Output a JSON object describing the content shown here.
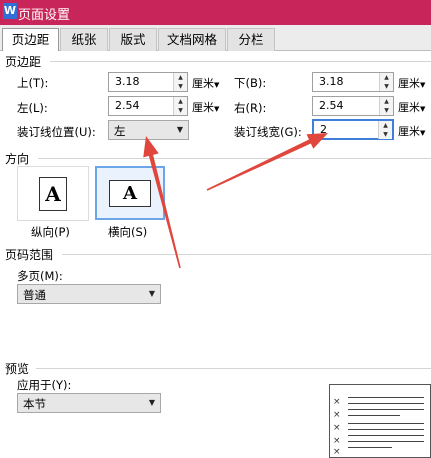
{
  "window": {
    "title": "页面设置",
    "app_icon": "W"
  },
  "tabs": [
    {
      "label": "页边距",
      "active": true
    },
    {
      "label": "纸张",
      "active": false
    },
    {
      "label": "版式",
      "active": false
    },
    {
      "label": "文档网格",
      "active": false
    },
    {
      "label": "分栏",
      "active": false
    }
  ],
  "margins": {
    "section_title": "页边距",
    "top": {
      "label": "上(T):",
      "value": "3.18",
      "unit": "厘米"
    },
    "bottom": {
      "label": "下(B):",
      "value": "3.18",
      "unit": "厘米"
    },
    "left": {
      "label": "左(L):",
      "value": "2.54",
      "unit": "厘米"
    },
    "right": {
      "label": "右(R):",
      "value": "2.54",
      "unit": "厘米"
    },
    "gutter_position": {
      "label": "装订线位置(U):",
      "value": "左"
    },
    "gutter_width": {
      "label": "装订线宽(G):",
      "value": "2",
      "unit": "厘米"
    }
  },
  "orientation": {
    "section_title": "方向",
    "portrait": {
      "label": "纵向(P)",
      "glyph": "A",
      "selected": false
    },
    "landscape": {
      "label": "横向(S)",
      "glyph": "A",
      "selected": true
    }
  },
  "page_range": {
    "section_title": "页码范围",
    "multiple_pages": {
      "label": "多页(M):",
      "value": "普通"
    }
  },
  "preview": {
    "section_title": "预览",
    "apply_to": {
      "label": "应用于(Y):",
      "value": "本节"
    }
  },
  "annotation": {
    "arrow_color": "#e0463c"
  }
}
